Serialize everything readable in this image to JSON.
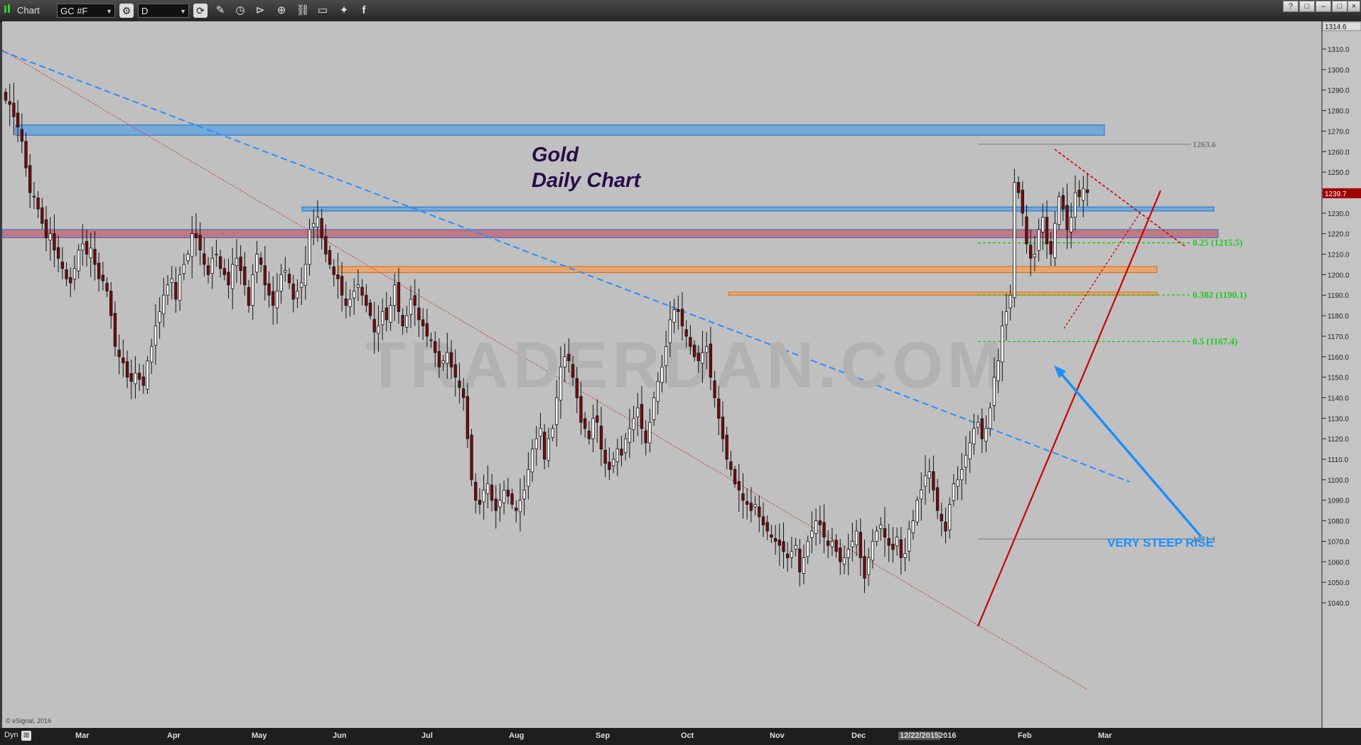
{
  "app": {
    "title": "Chart",
    "symbol": "GC #F",
    "interval": "D",
    "window_buttons": [
      "?",
      "□",
      "–",
      "□",
      "×"
    ]
  },
  "toolbar_icons": [
    "gear-icon",
    "refresh-icon",
    "pencil-icon",
    "clock-icon",
    "play-icon",
    "search-icon",
    "link-icon",
    "comment-icon",
    "twitter-icon",
    "facebook-icon"
  ],
  "bottom": {
    "mode_label": "Dyn"
  },
  "colors": {
    "background": "#c0c0c0",
    "up_candle": "#ffffff",
    "down_candle": "#7a0a0a",
    "fib_green": "#00dd00",
    "accent_blue": "#1a8fff",
    "trend_red": "#cc0000",
    "title_purple": "#2b0a4a"
  },
  "chart_data": {
    "type": "candlestick",
    "title_line1": "Gold",
    "title_line2": "Daily Chart",
    "watermark": "TRADERDAN.COM",
    "copyright": "© eSignal, 2016",
    "x_labels": [
      "Mar",
      "Apr",
      "May",
      "Jun",
      "Jul",
      "Aug",
      "Sep",
      "Oct",
      "Nov",
      "Dec",
      "12/22/2015",
      "2016",
      "Feb",
      "Mar"
    ],
    "y_ticks": [
      1040,
      1050,
      1060,
      1070,
      1080,
      1090,
      1100,
      1110,
      1120,
      1130,
      1140,
      1150,
      1160,
      1170,
      1180,
      1190,
      1200,
      1210,
      1220,
      1230,
      1240,
      1250,
      1260,
      1270,
      1280,
      1290,
      1300,
      1310
    ],
    "y_tick_labels": [
      "1040.0",
      "1050.0",
      "1060.0",
      "1070.0",
      "1080.0",
      "1090.0",
      "1100.0",
      "1110.0",
      "1120.0",
      "1130.0",
      "1140.0",
      "1150.0",
      "1160.0",
      "1170.0",
      "1180.0",
      "1190.0",
      "1200.0",
      "1210.0",
      "1220.0",
      "1230.0",
      "1240.0",
      "1250.0",
      "1260.0",
      "1270.0",
      "1280.0",
      "1290.0",
      "1300.0",
      "1310.0"
    ],
    "ylim": [
      1034,
      1315
    ],
    "top_price_label": "1314.6",
    "last_price": 1239.7,
    "last_price_label": "1239.7",
    "level_labels": [
      {
        "price": 1263.6,
        "text": "1263.6"
      },
      {
        "price": 1071.1,
        "text": "1071.1"
      }
    ],
    "fib_levels": [
      {
        "price": 1215.5,
        "text": "0.25 (1215.5)"
      },
      {
        "price": 1190.1,
        "text": "0.382 (1190.1)"
      },
      {
        "price": 1167.4,
        "text": "0.5 (1167.4)"
      }
    ],
    "annotation": "VERY STEEP RISE",
    "zones": [
      {
        "low": 1268,
        "high": 1273,
        "color": "blue"
      },
      {
        "low": 1231,
        "high": 1233,
        "color": "blue"
      },
      {
        "low": 1218,
        "high": 1222,
        "color": "red"
      },
      {
        "low": 1201,
        "high": 1204,
        "color": "orange"
      },
      {
        "low": 1190,
        "high": 1191.5,
        "color": "orange"
      }
    ],
    "closes": [
      1285,
      1283,
      1277,
      1272,
      1265,
      1252,
      1240,
      1238,
      1232,
      1225,
      1218,
      1220,
      1212,
      1208,
      1203,
      1198,
      1196,
      1203,
      1212,
      1215,
      1210,
      1213,
      1205,
      1198,
      1197,
      1192,
      1180,
      1165,
      1160,
      1157,
      1150,
      1148,
      1152,
      1149,
      1146,
      1158,
      1165,
      1175,
      1182,
      1190,
      1195,
      1198,
      1188,
      1200,
      1205,
      1210,
      1220,
      1218,
      1212,
      1205,
      1200,
      1208,
      1210,
      1203,
      1200,
      1195,
      1205,
      1208,
      1202,
      1195,
      1185,
      1200,
      1210,
      1205,
      1195,
      1190,
      1185,
      1192,
      1200,
      1202,
      1196,
      1188,
      1192,
      1196,
      1205,
      1222,
      1225,
      1228,
      1218,
      1210,
      1205,
      1200,
      1198,
      1190,
      1185,
      1188,
      1192,
      1195,
      1190,
      1185,
      1180,
      1172,
      1175,
      1182,
      1178,
      1185,
      1195,
      1182,
      1175,
      1180,
      1188,
      1185,
      1178,
      1175,
      1170,
      1168,
      1162,
      1155,
      1158,
      1162,
      1155,
      1150,
      1145,
      1140,
      1120,
      1100,
      1090,
      1088,
      1095,
      1098,
      1090,
      1085,
      1090,
      1095,
      1092,
      1088,
      1085,
      1090,
      1095,
      1105,
      1115,
      1120,
      1125,
      1110,
      1120,
      1125,
      1140,
      1155,
      1160,
      1158,
      1150,
      1140,
      1128,
      1125,
      1120,
      1130,
      1128,
      1115,
      1108,
      1105,
      1110,
      1115,
      1112,
      1120,
      1125,
      1130,
      1135,
      1125,
      1118,
      1128,
      1140,
      1148,
      1155,
      1165,
      1178,
      1183,
      1182,
      1175,
      1170,
      1165,
      1160,
      1158,
      1162,
      1165,
      1150,
      1140,
      1130,
      1120,
      1110,
      1105,
      1098,
      1095,
      1090,
      1088,
      1085,
      1088,
      1082,
      1078,
      1075,
      1072,
      1070,
      1068,
      1065,
      1062,
      1065,
      1068,
      1055,
      1062,
      1070,
      1075,
      1080,
      1078,
      1072,
      1068,
      1070,
      1065,
      1060,
      1062,
      1066,
      1070,
      1075,
      1062,
      1052,
      1062,
      1070,
      1075,
      1078,
      1072,
      1068,
      1066,
      1072,
      1062,
      1064,
      1076,
      1080,
      1090,
      1095,
      1102,
      1104,
      1095,
      1085,
      1080,
      1075,
      1088,
      1098,
      1100,
      1105,
      1112,
      1118,
      1125,
      1128,
      1120,
      1125,
      1135,
      1150,
      1158,
      1175,
      1182,
      1190,
      1245,
      1240,
      1230,
      1215,
      1208,
      1210,
      1222,
      1228,
      1215,
      1210,
      1225,
      1238,
      1232,
      1222,
      1228,
      1240,
      1238,
      1242,
      1240
    ]
  }
}
